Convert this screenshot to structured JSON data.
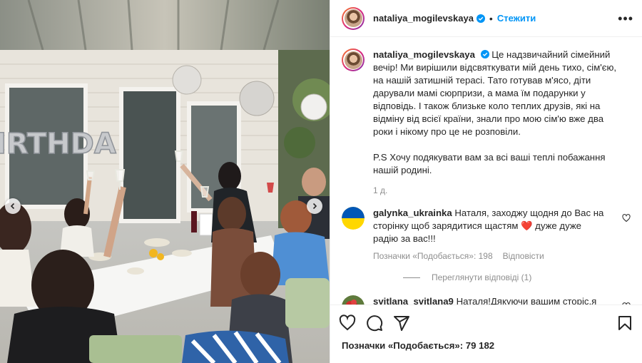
{
  "media": {
    "banner_letters": "IRTHDA",
    "nav_prev": "previous-slide",
    "nav_next": "next-slide"
  },
  "post": {
    "author": "nataliya_mogilevskaya",
    "follow_label": "Стежити",
    "separator": "•",
    "more_label": "•••",
    "caption": "Це надзвичайний сімейний вечір! Ми вирішили відсвяткувати мій день тихо, сім'єю, на нашій затишній терасі. Тато готував м'ясо, діти дарували мамі сюрпризи, а мама їм подарунки у відповідь. І також близьке коло теплих друзів, які на відміну від всієї країни, знали про мою сім'ю вже два роки і нікому про це не розповіли.",
    "caption_ps": "P.S Хочу подякувати вам за всі ваші теплі побажання нашій родині.",
    "time": "1 д.",
    "likes": "Позначки «Подобається»: 79 182"
  },
  "comments": [
    {
      "user": "galynka_ukrainka",
      "text": "Наталя, заходжу щодня до Вас на сторінку щоб зарядитися щастям ❤️ дуже дуже радію за вас!!!",
      "likes": "Позначки «Подобається»: 198",
      "reply": "Відповісти",
      "view_replies": "Переглянути відповіді (1)"
    },
    {
      "user": "svitlana_svitlana9",
      "text": "Наталя!Дякуючи вашим сторіс,я зрозуміла,що можна радіти за чужу сім'ю.Від чистого серця бажаю вам простого щастя!Хай потихеньку збуваються усі мрії.Думаю,що для дітей просто рай у вашій родині.Вони витягли щасливий квіток !Діти!Будьте вдячні вашій матусі"
    }
  ],
  "colors": {
    "link": "#0095f6",
    "muted": "#8e8e8e",
    "heart": "#ed4956",
    "ua_blue": "#0057b7",
    "ua_yellow": "#ffd700"
  }
}
